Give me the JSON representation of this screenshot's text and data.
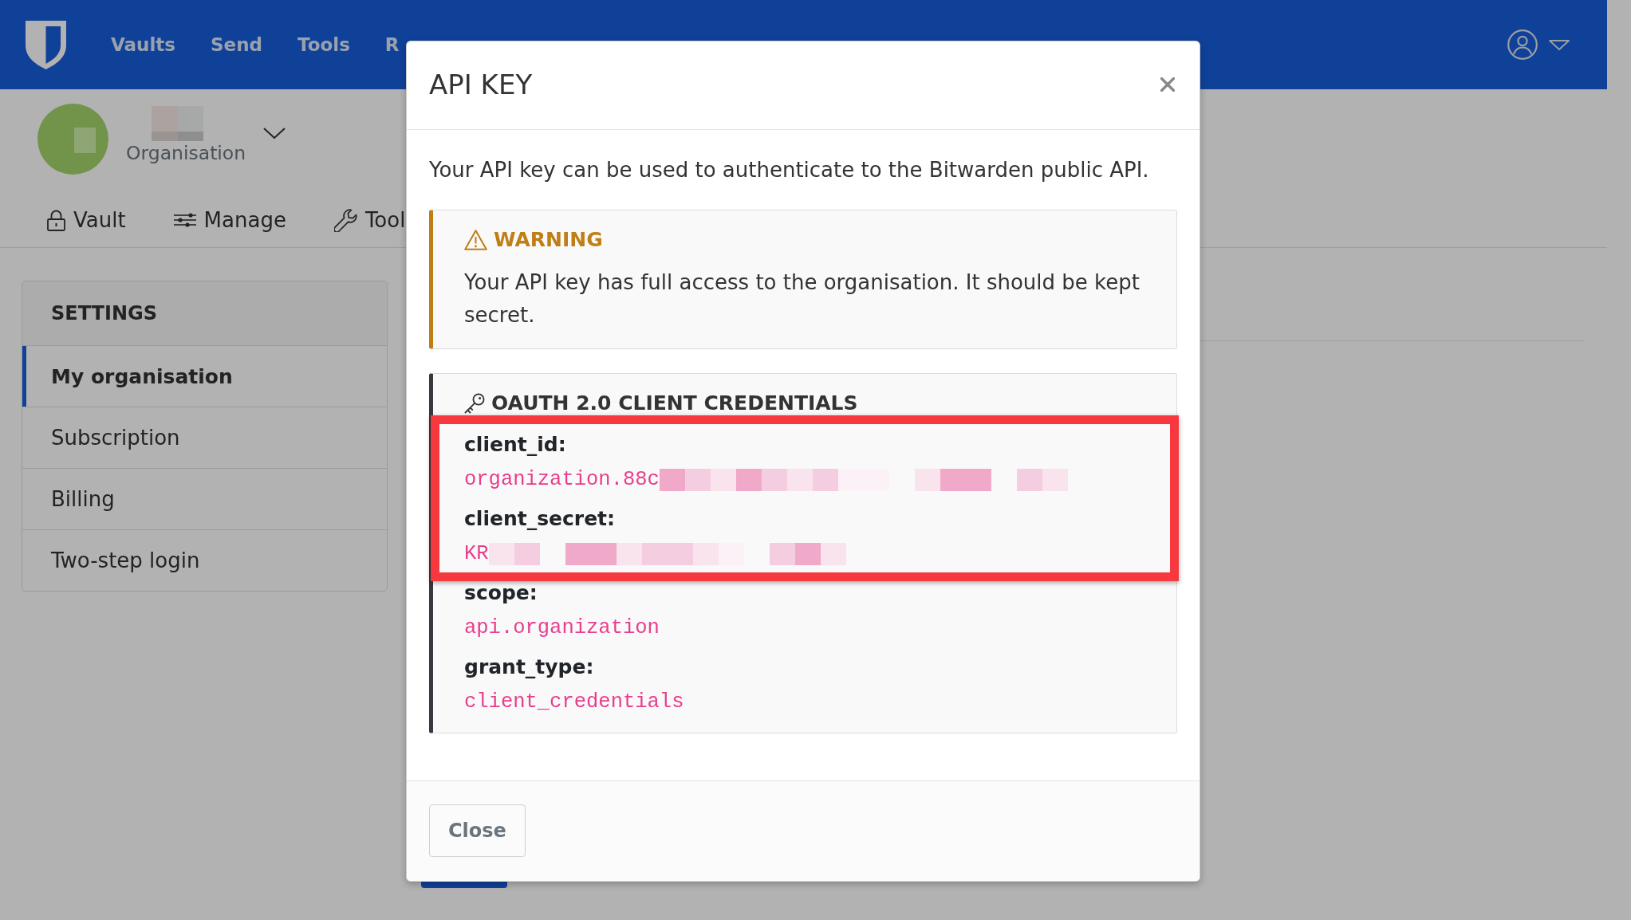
{
  "top_nav": {
    "links": [
      {
        "label": "Vaults"
      },
      {
        "label": "Send"
      },
      {
        "label": "Tools"
      },
      {
        "label": "R"
      }
    ]
  },
  "organisation": {
    "type_label": "Organisation"
  },
  "org_tabs": [
    {
      "label": "Vault"
    },
    {
      "label": "Manage"
    },
    {
      "label": "Tool"
    }
  ],
  "settings_menu": {
    "title": "SETTINGS",
    "items": [
      {
        "label": "My organisation",
        "selected": true
      },
      {
        "label": "Subscription",
        "selected": false
      },
      {
        "label": "Billing",
        "selected": false
      },
      {
        "label": "Two-step login",
        "selected": false
      }
    ]
  },
  "modal": {
    "title": "API KEY",
    "description": "Your API key can be used to authenticate to the Bitwarden public API.",
    "warning": {
      "title": "WARNING",
      "text": "Your API key has full access to the organisation. It should be kept secret."
    },
    "credentials": {
      "title": "OAUTH 2.0 CLIENT CREDENTIALS",
      "fields": [
        {
          "label": "client_id:",
          "value": "organization.88c",
          "redacted": true,
          "highlighted": true
        },
        {
          "label": "client_secret:",
          "value": "KR",
          "redacted": true,
          "highlighted": true
        },
        {
          "label": "scope:",
          "value": "api.organization",
          "redacted": false,
          "highlighted": false
        },
        {
          "label": "grant_type:",
          "value": "client_credentials",
          "redacted": false,
          "highlighted": false
        }
      ]
    },
    "buttons": [
      {
        "label": "Close"
      }
    ]
  }
}
